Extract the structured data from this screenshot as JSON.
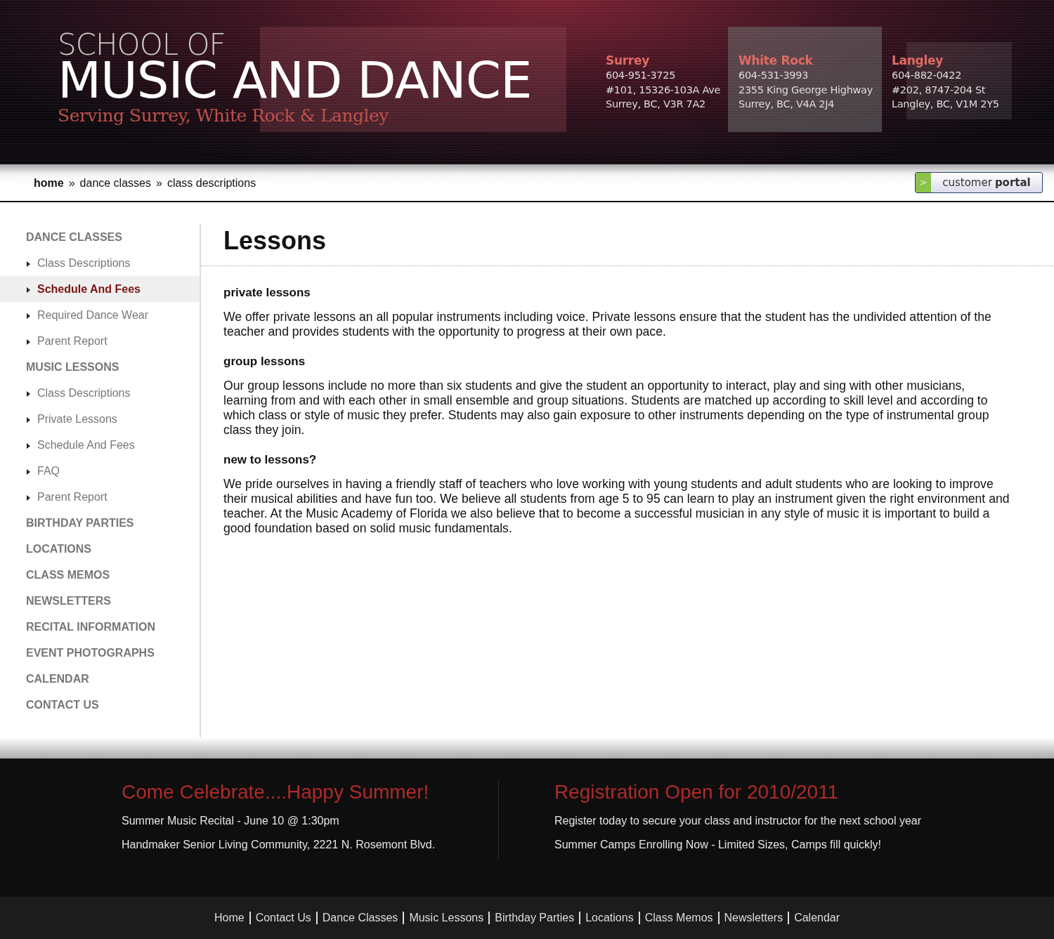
{
  "header": {
    "logo_top": "SCHOOL OF",
    "logo_main": "MUSIC AND DANCE",
    "tagline": "Serving Surrey, White Rock & Langley",
    "locations": [
      {
        "name": "Surrey",
        "phone": "604-951-3725",
        "address": "#101, 15326-103A Ave",
        "city": "Surrey, BC, V3R 7A2"
      },
      {
        "name": "White Rock",
        "phone": "604-531-3993",
        "address": "2355 King George Highway",
        "city": "Surrey, BC, V4A 2J4"
      },
      {
        "name": "Langley",
        "phone": "604-882-0422",
        "address": "#202, 8747-204 St",
        "city": "Langley, BC, V1M 2Y5"
      }
    ]
  },
  "breadcrumb": [
    {
      "label": "home",
      "bold": true
    },
    {
      "label": "dance classes",
      "bold": false
    },
    {
      "label": "class descriptions",
      "bold": false
    }
  ],
  "breadcrumb_separator": "»",
  "portal_button": {
    "arrow": ">",
    "label": "customer",
    "label_bold": "portal"
  },
  "sidebar": {
    "items": [
      {
        "kind": "heading",
        "label": "DANCE CLASSES",
        "selected": false
      },
      {
        "kind": "link",
        "label": "Class Descriptions",
        "selected": false
      },
      {
        "kind": "link",
        "label": "Schedule And Fees",
        "selected": true
      },
      {
        "kind": "link",
        "label": "Required Dance Wear",
        "selected": false
      },
      {
        "kind": "link",
        "label": "Parent Report",
        "selected": false
      },
      {
        "kind": "heading",
        "label": "MUSIC LESSONS",
        "selected": false
      },
      {
        "kind": "link",
        "label": "Class Descriptions",
        "selected": false
      },
      {
        "kind": "link",
        "label": "Private Lessons",
        "selected": false
      },
      {
        "kind": "link",
        "label": "Schedule And Fees",
        "selected": false
      },
      {
        "kind": "link",
        "label": "FAQ",
        "selected": false
      },
      {
        "kind": "link",
        "label": "Parent Report",
        "selected": false
      },
      {
        "kind": "heading",
        "label": "BIRTHDAY PARTIES",
        "selected": false
      },
      {
        "kind": "heading",
        "label": "LOCATIONS",
        "selected": false
      },
      {
        "kind": "heading",
        "label": "CLASS MEMOS",
        "selected": false
      },
      {
        "kind": "heading",
        "label": "NEWSLETTERS",
        "selected": false
      },
      {
        "kind": "heading",
        "label": "RECITAL INFORMATION",
        "selected": false
      },
      {
        "kind": "heading",
        "label": "EVENT PHOTOGRAPHS",
        "selected": false
      },
      {
        "kind": "heading",
        "label": "CALENDAR",
        "selected": false
      },
      {
        "kind": "heading",
        "label": "CONTACT US",
        "selected": false
      }
    ]
  },
  "content": {
    "title": "Lessons",
    "sections": [
      {
        "heading": "private lessons",
        "text": "We offer private lessons an all popular instruments including voice. Private lessons ensure that the student has the undivided attention of the teacher and provides students with the opportunity to progress at their own pace."
      },
      {
        "heading": "group lessons",
        "text": "Our group lessons include no more than six students and give the student an opportunity to interact, play and sing with other musicians, learning from and with each other in small ensemble and group situations. Students are matched up according to skill level and according to which class or style of music they prefer. Students may also gain exposure to other instruments depending on the type of instrumental group class they join."
      },
      {
        "heading": "new to lessons?",
        "text": "We pride ourselves in having a friendly staff of teachers who love working with young students and adult students who are looking to improve their musical abilities and have fun too. We believe all students from age 5 to 95 can learn to play an instrument given the right environment and teacher. At the Music Academy of Florida we also believe that to become a successful musician in any style of music it is important to build a good foundation based on solid music fundamentals."
      }
    ]
  },
  "promos": [
    {
      "title": "Come Celebrate....Happy Summer!",
      "lines": [
        "Summer Music Recital - June 10 @ 1:30pm",
        "Handmaker Senior Living Community, 2221 N. Rosemont Blvd."
      ]
    },
    {
      "title": "Registration Open for 2010/2011",
      "lines": [
        "Register today to secure your class and instructor for the next school year",
        "Summer Camps Enrolling Now - Limited Sizes, Camps fill quickly!"
      ]
    }
  ],
  "footer_links": [
    "Home",
    "Contact Us",
    "Dance Classes",
    "Music Lessons",
    "Birthday Parties",
    "Locations",
    "Class Memos",
    "Newsletters",
    "Calendar"
  ]
}
